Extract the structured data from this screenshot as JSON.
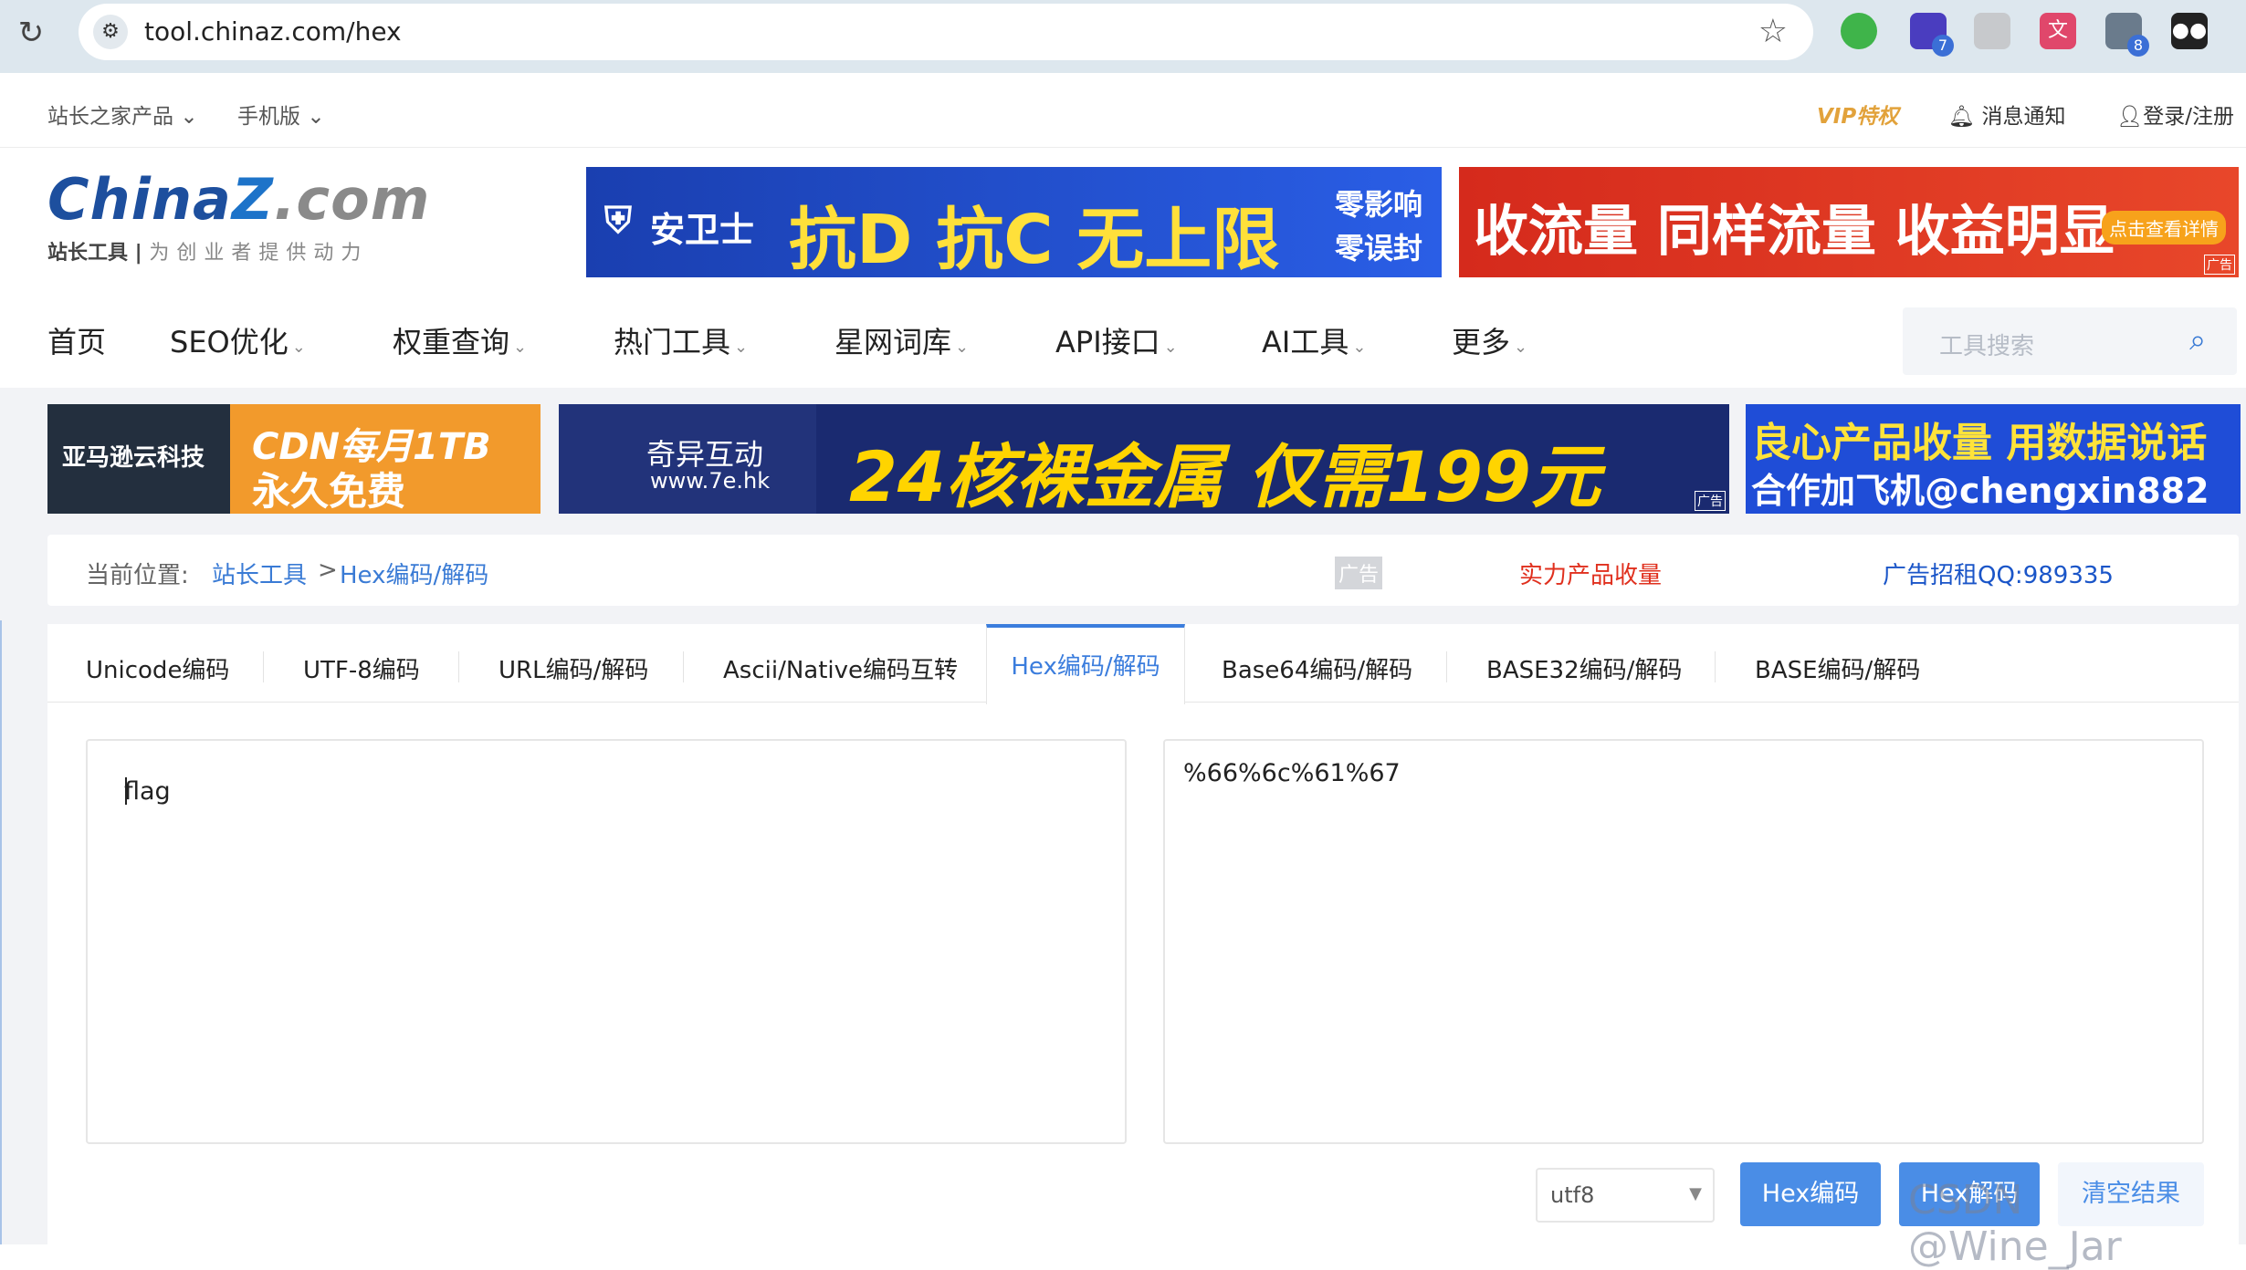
{
  "browser": {
    "url": "tool.chinaz.com/hex",
    "extensions": [
      {
        "icon": "circle-extension-icon",
        "color": "#3fb44a",
        "badge": ""
      },
      {
        "icon": "cube-extension-icon",
        "color": "#4a3dbf",
        "badge": "7"
      },
      {
        "icon": "diamond-extension-icon",
        "color": "#c7c9cc",
        "badge": ""
      },
      {
        "icon": "translate-extension-icon",
        "color": "#e0476b",
        "badge": ""
      },
      {
        "icon": "robot-extension-icon",
        "color": "#6a7b8c",
        "badge": "8"
      },
      {
        "icon": "panda-extension-icon",
        "color": "#222222",
        "badge": ""
      }
    ]
  },
  "topnav": {
    "products": "站长之家产品",
    "mobile": "手机版",
    "vip": "VIP特权",
    "notify": "消息通知",
    "login": "登录/注册"
  },
  "logo": {
    "brand_a": "China",
    "brand_z": "Z",
    "brand_com": ".com",
    "tagline": "站长工具",
    "slogan": "为创业者提供动力"
  },
  "banners": {
    "b1_brand": "安卫士",
    "b1_main": "抗D 抗C 无上限",
    "b1_side_1": "零影响",
    "b1_side_2": "零误封",
    "b2_main": "收流量 同样流量 收益明显",
    "b2_button": "点击查看详情",
    "b3_left": "亚马逊云科技",
    "b3_right_1": "CDN每月1TB",
    "b3_right_2": "永久免费",
    "b4_left_1": "奇异互动",
    "b4_left_2": "www.7e.hk",
    "b4_main": "24核裸金属 仅需199元",
    "b5_line_1": "良心产品收量 用数据说话",
    "b5_line_2": "合作加飞机@chengxin882",
    "ad_label": "广告"
  },
  "mainnav": {
    "items": [
      "首页",
      "SEO优化",
      "权重查询",
      "热门工具",
      "星网词库",
      "API接口",
      "AI工具",
      "更多"
    ],
    "search_placeholder": "工具搜索"
  },
  "breadcrumb": {
    "prefix": "当前位置:",
    "root": "站长工具",
    "sep": ">",
    "current": "Hex编码/解码",
    "ad_tag": "广告",
    "ad_text": "实力产品收量",
    "contact": "广告招租QQ:989335"
  },
  "tabs": [
    "Unicode编码",
    "UTF-8编码",
    "URL编码/解码",
    "Ascii/Native编码互转",
    "Hex编码/解码",
    "Base64编码/解码",
    "BASE32编码/解码",
    "BASE编码/解码"
  ],
  "active_tab": "Hex编码/解码",
  "editor": {
    "input": "flag",
    "output": "%66%6c%61%67",
    "encoding": "utf8",
    "encode_btn": "Hex编码",
    "decode_btn": "Hex解码",
    "clear_btn": "清空结果"
  },
  "watermark": "CSDN @Wine_Jar",
  "colors": {
    "accent": "#3b7ddd",
    "ad_red": "#e0301e",
    "link_blue": "#3a7bd5"
  }
}
